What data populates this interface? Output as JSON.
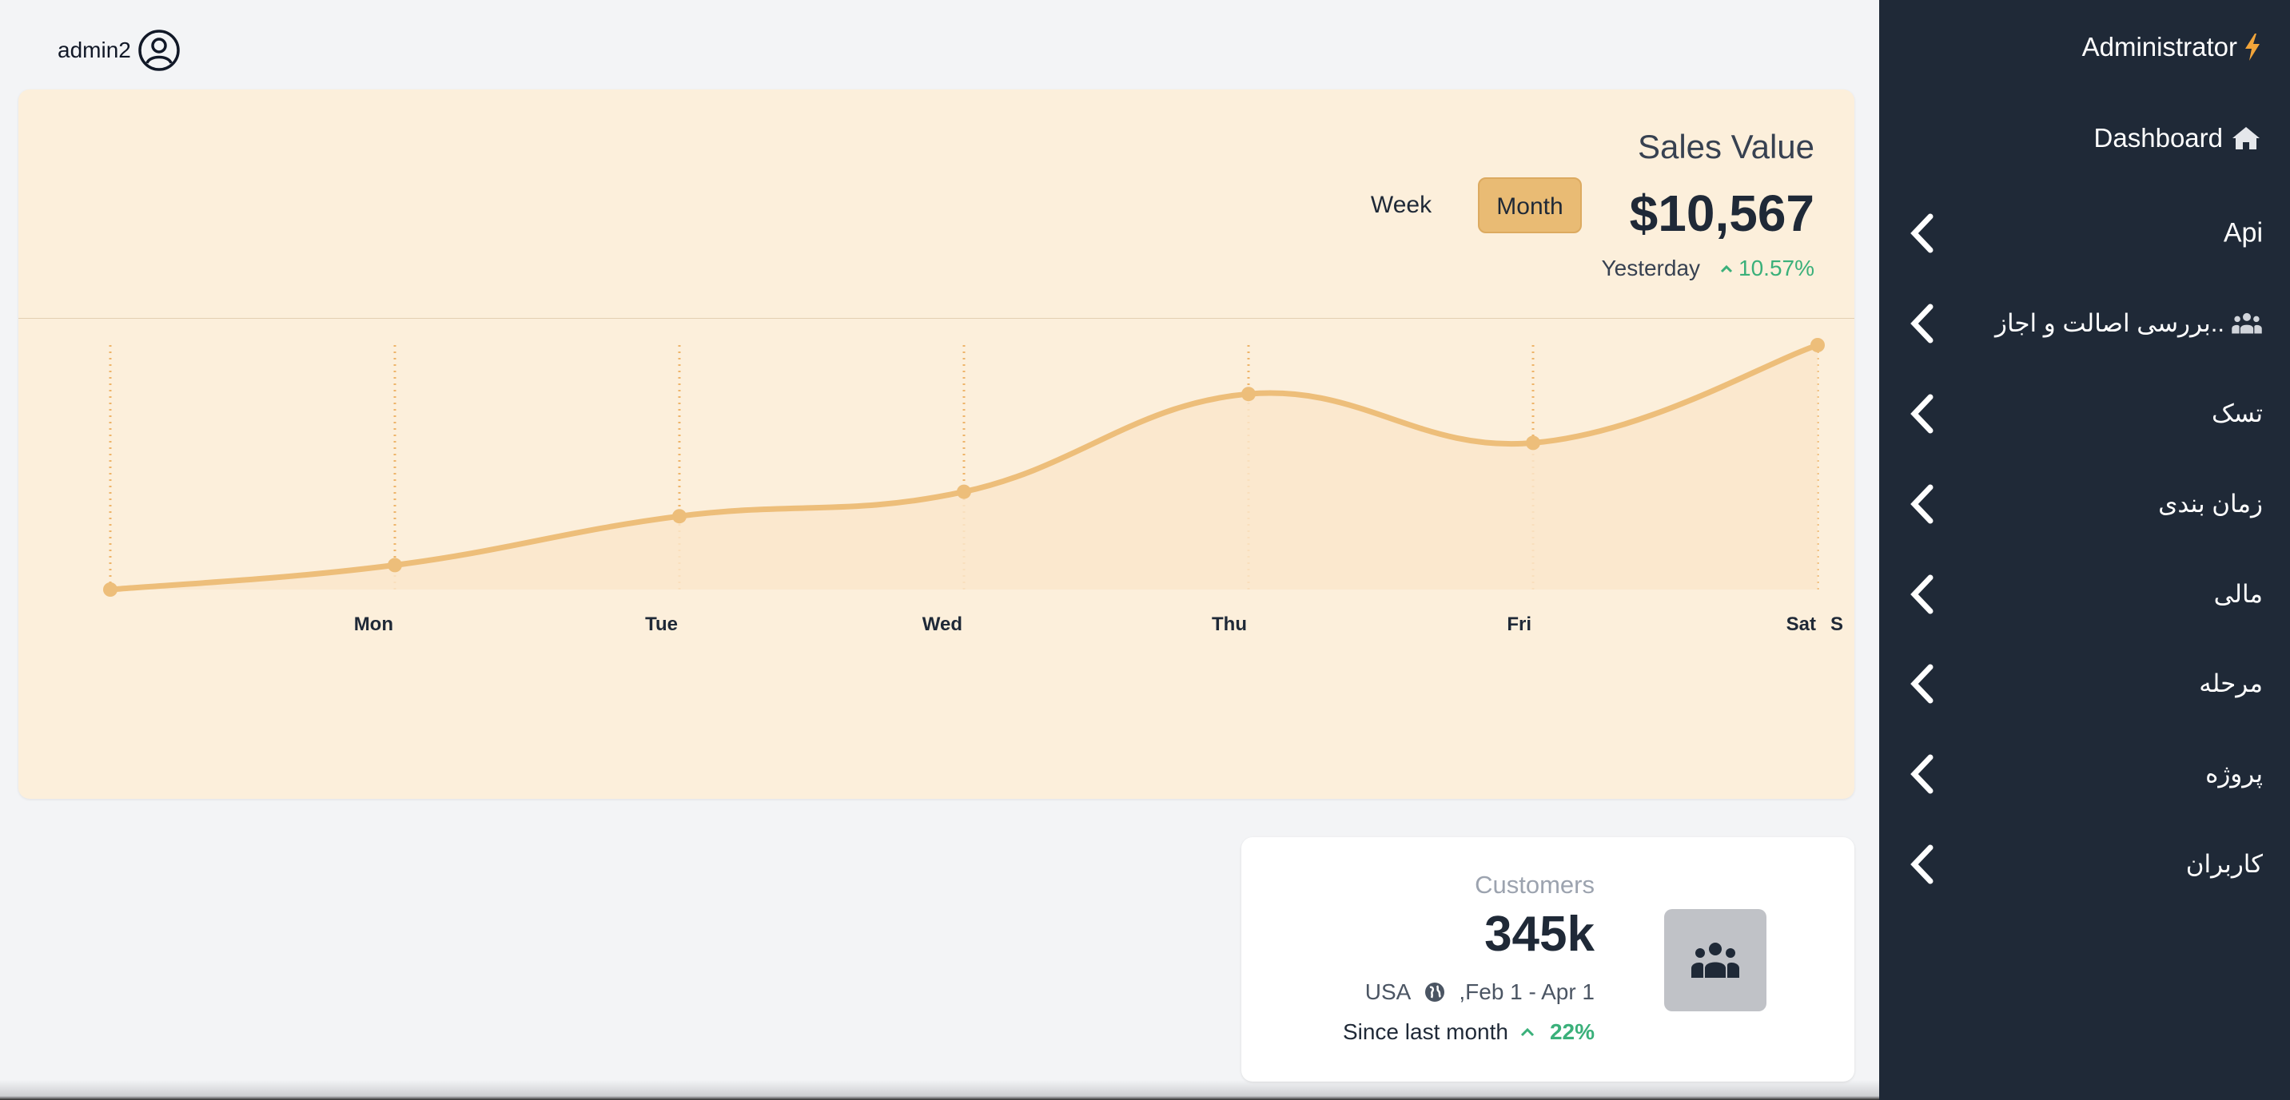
{
  "header": {
    "username": "admin2",
    "user_icon": "user-circle-icon"
  },
  "sales": {
    "title": "Sales Value",
    "value": "$10,567",
    "week_label": "Week",
    "month_label": "Month",
    "selected_period": "Month",
    "yesterday_label": "Yesterday",
    "change": "10.57%",
    "change_icon": "chevron-up-icon"
  },
  "chart_data": {
    "type": "area",
    "categories": [
      "",
      "Mon",
      "Tue",
      "Wed",
      "Thu",
      "Fri",
      "Sat",
      "S"
    ],
    "values": [
      0,
      10,
      30,
      40,
      80,
      60,
      100
    ],
    "ylim": [
      0,
      100
    ],
    "grid": "vertical-dotted",
    "colors": {
      "line": "#edbe7a",
      "fill": "#fae6cb",
      "grid": "#eeb46a"
    }
  },
  "customers": {
    "label": "Customers",
    "value": "345k",
    "location": "USA",
    "date_range": ",Feb 1 - Apr 1",
    "since_label": "Since last month",
    "change": "22%",
    "icon": "users-icon"
  },
  "sidebar": {
    "brand": "Administrator",
    "brand_icon": "bolt-icon",
    "dashboard": "Dashboard",
    "dashboard_icon": "home-icon",
    "items": [
      {
        "label": "Api"
      },
      {
        "label": "بررسی اصالت و اجاز..",
        "icon": "users-icon"
      },
      {
        "label": "تسک"
      },
      {
        "label": "زمان بندی"
      },
      {
        "label": "مالی"
      },
      {
        "label": "مرحله"
      },
      {
        "label": "پروژه"
      },
      {
        "label": "کاربران"
      }
    ]
  },
  "colors": {
    "accent": "#e9bb74",
    "sidebar_bg": "#1f2937",
    "card_bg": "#fcefdb",
    "positive": "#3ab07a",
    "bolt": "#f2a53a"
  }
}
